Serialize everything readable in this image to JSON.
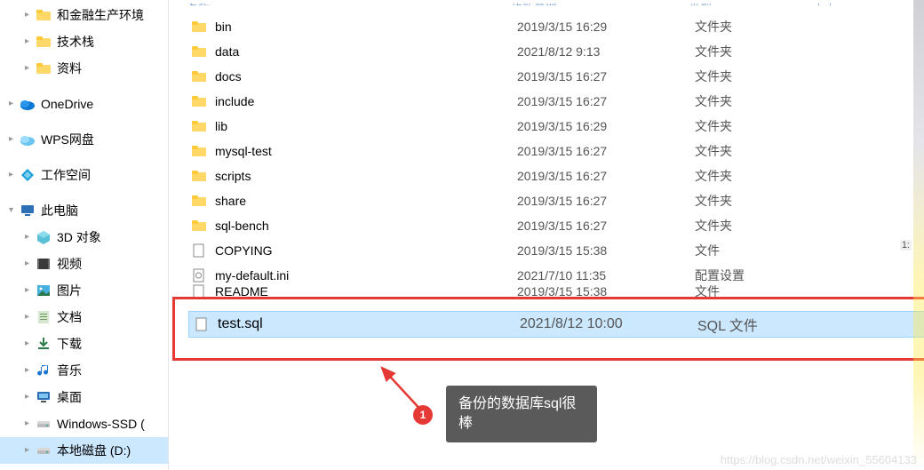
{
  "sidebar": {
    "items": [
      {
        "label": "和金融生产环境",
        "icon": "folder",
        "chev": "▸",
        "indent": "indent1"
      },
      {
        "label": "技术栈",
        "icon": "folder",
        "chev": "▸",
        "indent": "indent1"
      },
      {
        "label": "资料",
        "icon": "folder",
        "chev": "▸",
        "indent": "indent1"
      },
      {
        "label": "OneDrive",
        "icon": "onedrive",
        "chev": "▸",
        "indent": ""
      },
      {
        "label": "WPS网盘",
        "icon": "wps",
        "chev": "▸",
        "indent": ""
      },
      {
        "label": "工作空间",
        "icon": "workspace",
        "chev": "▸",
        "indent": ""
      },
      {
        "label": "此电脑",
        "icon": "thispc",
        "chev": "▾",
        "indent": ""
      },
      {
        "label": "3D 对象",
        "icon": "3d",
        "chev": "▸",
        "indent": "indent1"
      },
      {
        "label": "视频",
        "icon": "video",
        "chev": "▸",
        "indent": "indent1"
      },
      {
        "label": "图片",
        "icon": "image",
        "chev": "▸",
        "indent": "indent1"
      },
      {
        "label": "文档",
        "icon": "doc",
        "chev": "▸",
        "indent": "indent1"
      },
      {
        "label": "下载",
        "icon": "download",
        "chev": "▸",
        "indent": "indent1"
      },
      {
        "label": "音乐",
        "icon": "music",
        "chev": "▸",
        "indent": "indent1"
      },
      {
        "label": "桌面",
        "icon": "desktop",
        "chev": "▸",
        "indent": "indent1"
      },
      {
        "label": "Windows-SSD (",
        "icon": "drive",
        "chev": "▸",
        "indent": "indent1"
      },
      {
        "label": "本地磁盘 (D:)",
        "icon": "drive",
        "chev": "▸",
        "indent": "indent1",
        "selected": true
      }
    ]
  },
  "columns": {
    "name": "名称",
    "date": "修改日期",
    "type": "类型",
    "size": "大小"
  },
  "files": [
    {
      "name": "bin",
      "date": "2019/3/15 16:29",
      "type": "文件夹",
      "icon": "folder"
    },
    {
      "name": "data",
      "date": "2021/8/12 9:13",
      "type": "文件夹",
      "icon": "folder"
    },
    {
      "name": "docs",
      "date": "2019/3/15 16:27",
      "type": "文件夹",
      "icon": "folder"
    },
    {
      "name": "include",
      "date": "2019/3/15 16:27",
      "type": "文件夹",
      "icon": "folder"
    },
    {
      "name": "lib",
      "date": "2019/3/15 16:29",
      "type": "文件夹",
      "icon": "folder"
    },
    {
      "name": "mysql-test",
      "date": "2019/3/15 16:27",
      "type": "文件夹",
      "icon": "folder"
    },
    {
      "name": "scripts",
      "date": "2019/3/15 16:27",
      "type": "文件夹",
      "icon": "folder"
    },
    {
      "name": "share",
      "date": "2019/3/15 16:27",
      "type": "文件夹",
      "icon": "folder"
    },
    {
      "name": "sql-bench",
      "date": "2019/3/15 16:27",
      "type": "文件夹",
      "icon": "folder"
    },
    {
      "name": "COPYING",
      "date": "2019/3/15 15:38",
      "type": "文件",
      "icon": "file"
    },
    {
      "name": "my-default.ini",
      "date": "2021/7/10 11:35",
      "type": "配置设置",
      "icon": "ini"
    }
  ],
  "readme": {
    "name": "README",
    "date": "2019/3/15 15:38",
    "type": "文件"
  },
  "highlighted": {
    "name": "test.sql",
    "date": "2021/8/12 10:00",
    "type": "SQL 文件",
    "icon": "file"
  },
  "scroll_marker": "1:",
  "annotation": {
    "badge": "1",
    "text": "备份的数据库sql很棒"
  },
  "watermark": "https://blog.csdn.net/weixin_55604133"
}
